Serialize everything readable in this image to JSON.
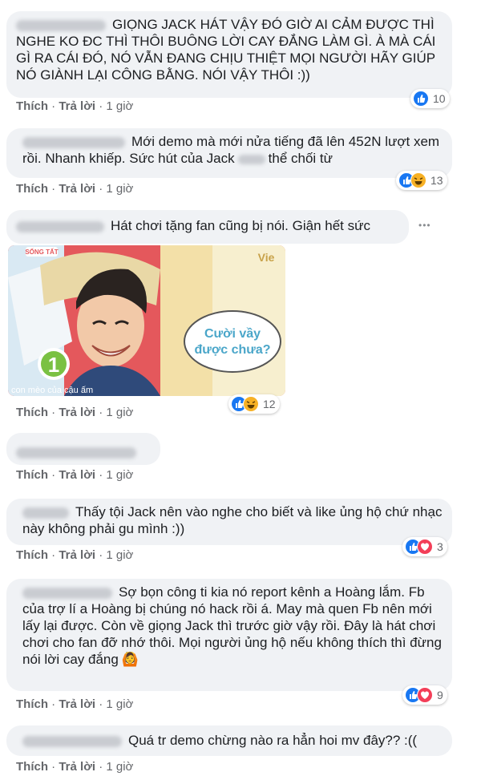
{
  "comments": [
    {
      "text": "GIỌNG JACK HÁT VẬY ĐÓ GIỜ AI CẢM ĐƯỢC THÌ NGHE KO ĐC THÌ THÔI BUÔNG LỜI CAY ĐẮNG LÀM GÌ. À MÀ CÁI GÌ RA CÁI ĐÓ, NÓ VẪN ĐANG CHỊU THIỆT MỌI NGƯỜI HÃY GIÚP NÓ GIÀNH LẠI CÔNG BẰNG. NÓI VẬY THÔI :))",
      "like": "Thích",
      "reply": "Trả lời",
      "time": "1 giờ",
      "count": "10"
    },
    {
      "text_a": "Mới demo mà mới nửa tiếng đã lên 452N lượt xem rồi. Nhanh khiếp. Sức hút của Jack",
      "text_b": "thể chối từ",
      "like": "Thích",
      "reply": "Trả lời",
      "time": "1 giờ",
      "count": "13"
    },
    {
      "text": "Hát chơi tặng fan cũng bị nói. Giận hết sức",
      "more": "•••"
    },
    {
      "sticker": {
        "logo": "SỐNG TẤT",
        "brand": "Vie",
        "number": "1",
        "bubble_line1": "Cười vầy",
        "bubble_line2": "được chưa?",
        "caption": "con mèo của cậu ấm"
      },
      "like": "Thích",
      "reply": "Trả lời",
      "time": "1 giờ",
      "count": "12"
    },
    {
      "like": "Thích",
      "reply": "Trả lời",
      "time": "1 giờ"
    },
    {
      "text": "Thấy tội Jack nên vào nghe cho biết và like ủng hộ chứ nhạc này không phải gu mình :))",
      "like": "Thích",
      "reply": "Trả lời",
      "time": "1 giờ",
      "count": "3"
    },
    {
      "text": "Sợ bọn công ti kia nó report kênh a Hoàng lắm. Fb của trợ lí a Hoàng bị chúng nó hack rồi á. May mà quen Fb nên mới lấy lại được. Còn về giọng Jack thì trước giờ vậy rồi. Đây là hát chơi chơi cho fan đỡ nhớ thôi. Mọi người ủng hộ nếu không thích thì đừng nói lời cay đắng",
      "emoji": "🙆",
      "like": "Thích",
      "reply": "Trả lời",
      "time": "1 giờ",
      "count": "9"
    },
    {
      "text": "Quá tr demo chừng nào ra hẳn hoi mv đây?? :((",
      "like": "Thích",
      "reply": "Trả lời",
      "time": "1 giờ"
    }
  ],
  "colors": {
    "like": "#1877f2",
    "haha": "#f7b125",
    "love": "#f33e58",
    "bubble": "#f0f2f5",
    "meta": "#65676b"
  }
}
